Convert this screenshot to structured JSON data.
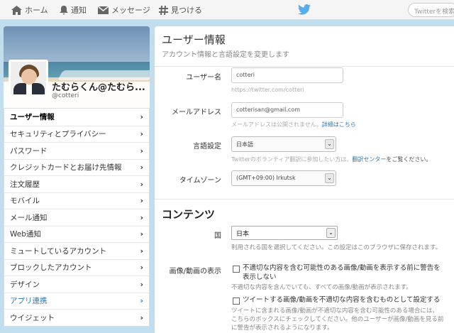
{
  "topbar": {
    "home": "ホーム",
    "notifications": "通知",
    "messages": "メッセージ",
    "discover": "見つける",
    "search_placeholder": "Twitterを検索"
  },
  "profile": {
    "name": "たむらくん@たむら...",
    "handle": "@cotteri"
  },
  "menu": [
    {
      "label": "ユーザー情報",
      "state": "active"
    },
    {
      "label": "セキュリティとプライバシー",
      "state": ""
    },
    {
      "label": "パスワード",
      "state": ""
    },
    {
      "label": "クレジットカードとお届け先情報",
      "state": ""
    },
    {
      "label": "注文履歴",
      "state": ""
    },
    {
      "label": "モバイル",
      "state": ""
    },
    {
      "label": "メール通知",
      "state": ""
    },
    {
      "label": "Web通知",
      "state": ""
    },
    {
      "label": "ミュートしているアカウント",
      "state": ""
    },
    {
      "label": "ブロックしたアカウント",
      "state": ""
    },
    {
      "label": "デザイン",
      "state": ""
    },
    {
      "label": "アプリ連携",
      "state": "current"
    },
    {
      "label": "ウイジェット",
      "state": ""
    }
  ],
  "menu_chevron": "›",
  "main": {
    "title": "ユーザー情報",
    "subtitle": "アカウント情報と言語設定を変更します",
    "username_label": "ユーザー名",
    "username_value": "cotteri",
    "username_hint": "https://twitter.com/cotteri",
    "email_label": "メールアドレス",
    "email_value": "cotterisan@gmail.com",
    "email_hint": "メールアドレスは公開されません。",
    "email_hint_link": "詳細はこちら",
    "language_label": "言語設定",
    "language_value": "日本語",
    "language_hint": "Twitterのボランティア翻訳に参加したい方は、",
    "language_hint_link": "翻訳センター",
    "language_hint_tail": "をご覧ください。",
    "timezone_label": "タイムゾーン",
    "timezone_value": "(GMT+09:00) Irkutsk",
    "content_title": "コンテンツ",
    "country_label": "国",
    "country_value": "日本",
    "country_note": "利用される国を選択してください。この設定はこのブラウザに保存されます。",
    "media_label": "画像/動画の表示",
    "media_opt1": "不適切な内容を含む可能性のある画像/動画を表示する前に警告を表示しない",
    "media_opt1_note": "不適切な内容を含んでいても、すべての画像/動画が表示されます。",
    "media_opt2": "ツイートする画像/動画を不適切な内容を含むものとして設定する",
    "media_opt2_note": "ツイートに含まれる画像/動画が不適切な内容を含む可能性のある場合には、こちらのボックスにチェックしてください。他のユーザーが画像/動画を見る前に警告が表示されるようになります。"
  },
  "colors": {
    "accent": "#2a7ab5",
    "background": "#c0deed",
    "bird": "#55acee"
  }
}
